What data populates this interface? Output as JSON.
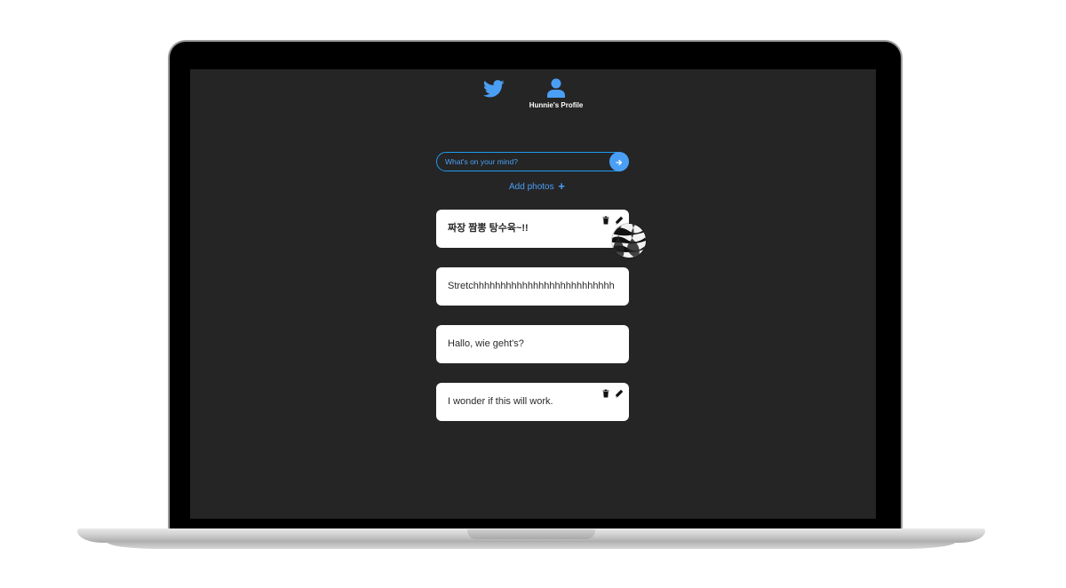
{
  "nav": {
    "home_icon": "twitter-bird-icon",
    "profile_icon": "user-icon",
    "profile_label": "Hunnie's Profile"
  },
  "compose": {
    "placeholder": "What's on your mind?",
    "submit_icon": "arrow-right-icon",
    "add_photos_label": "Add photos",
    "add_photos_icon": "plus-icon"
  },
  "tweets": [
    {
      "text": "짜장 짬뽕 탕수육~!!",
      "owned": true,
      "has_photo": true
    },
    {
      "text": "Stretchhhhhhhhhhhhhhhhhhhhhhhhhh",
      "owned": false,
      "has_photo": false
    },
    {
      "text": "Hallo, wie geht's?",
      "owned": false,
      "has_photo": false
    },
    {
      "text": "I wonder if this will work.",
      "owned": true,
      "has_photo": false
    }
  ],
  "actions": {
    "delete_icon": "trash-icon",
    "edit_icon": "pencil-icon"
  },
  "colors": {
    "accent": "#4a9ff5",
    "screen_bg": "#252525",
    "card_bg": "#ffffff"
  }
}
